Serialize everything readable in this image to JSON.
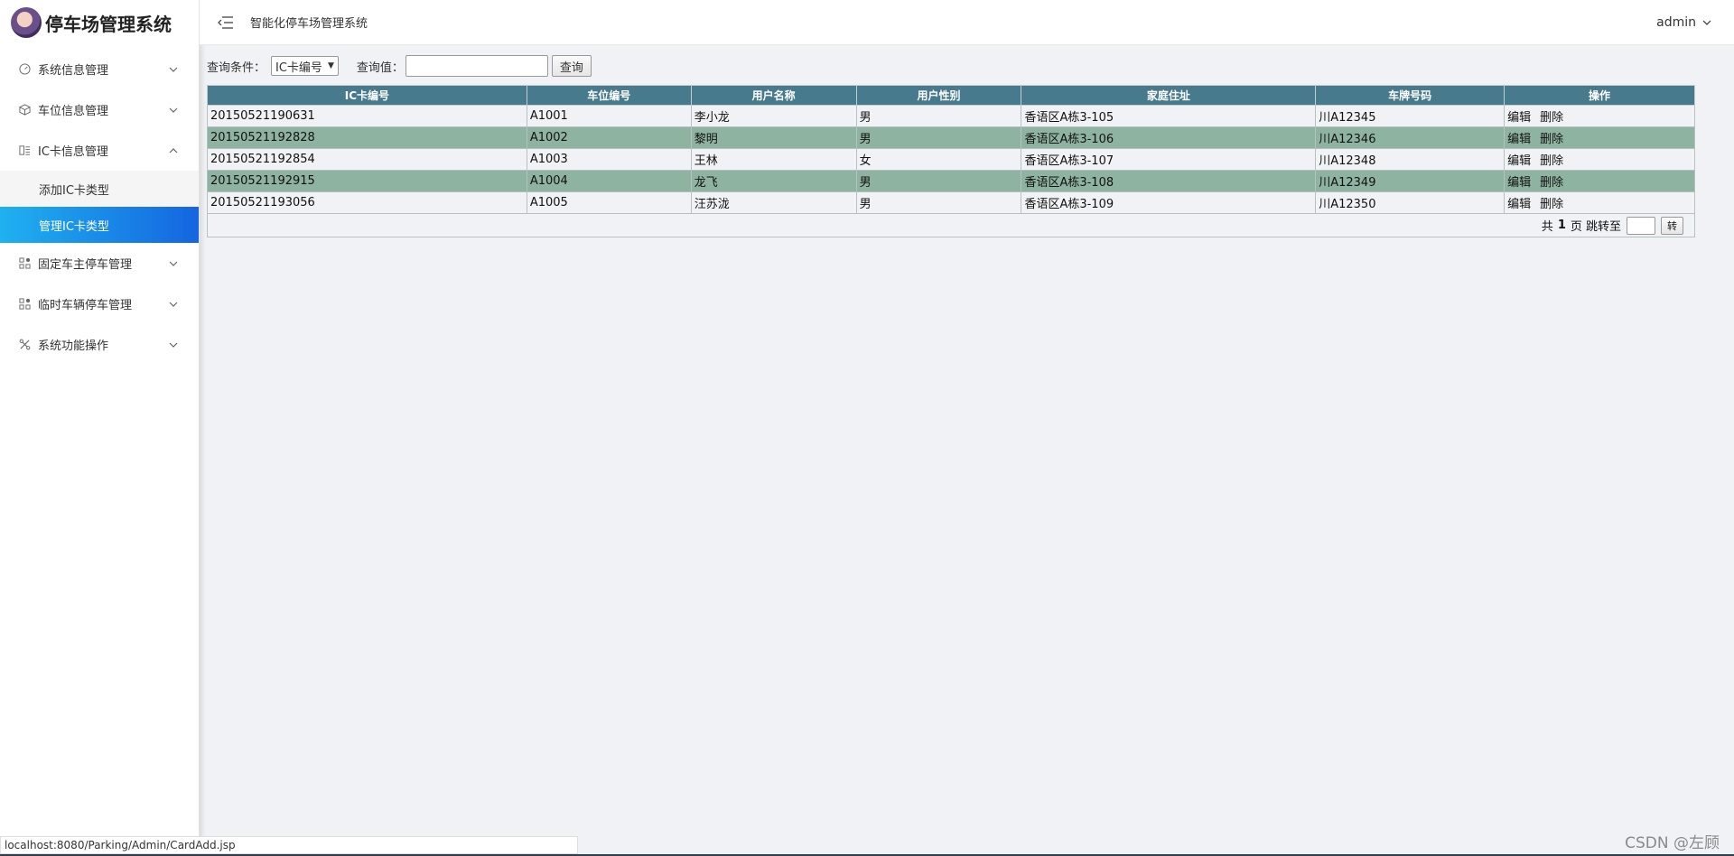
{
  "brand": {
    "title": "停车场管理系统"
  },
  "header": {
    "title": "智能化停车场管理系统",
    "user": "admin"
  },
  "sidebar": {
    "items": [
      {
        "label": "系统信息管理",
        "icon": "gauge-icon",
        "expanded": false
      },
      {
        "label": "车位信息管理",
        "icon": "cube-icon",
        "expanded": false
      },
      {
        "label": "IC卡信息管理",
        "icon": "card-icon",
        "expanded": true,
        "children": [
          {
            "label": "添加IC卡类型",
            "active": false
          },
          {
            "label": "管理IC卡类型",
            "active": true
          }
        ]
      },
      {
        "label": "固定车主停车管理",
        "icon": "grid-icon",
        "expanded": false
      },
      {
        "label": "临时车辆停车管理",
        "icon": "grid-icon",
        "expanded": false
      },
      {
        "label": "系统功能操作",
        "icon": "tools-icon",
        "expanded": false
      }
    ],
    "active_color": "#1e88e5"
  },
  "query": {
    "condition_label": "查询条件：",
    "condition_value": "IC卡编号",
    "value_label": "查询值：",
    "value": "",
    "button": "查询"
  },
  "table": {
    "header_color": "#467a8c",
    "row_alt_color": "#8fb3a1",
    "columns": [
      "IC卡编号",
      "车位编号",
      "用户名称",
      "用户性别",
      "家庭住址",
      "车牌号码",
      "操作"
    ],
    "rows": [
      {
        "card": "20150521190631",
        "slot": "A1001",
        "name": "李小龙",
        "gender": "男",
        "address": "香语区A栋3-105",
        "plate": "川A12345"
      },
      {
        "card": "20150521192828",
        "slot": "A1002",
        "name": "黎明",
        "gender": "男",
        "address": "香语区A栋3-106",
        "plate": "川A12346"
      },
      {
        "card": "20150521192854",
        "slot": "A1003",
        "name": "王林",
        "gender": "女",
        "address": "香语区A栋3-107",
        "plate": "川A12348"
      },
      {
        "card": "20150521192915",
        "slot": "A1004",
        "name": "龙飞",
        "gender": "男",
        "address": "香语区A栋3-108",
        "plate": "川A12349"
      },
      {
        "card": "20150521193056",
        "slot": "A1005",
        "name": "汪苏泷",
        "gender": "男",
        "address": "香语区A栋3-109",
        "plate": "川A12350"
      }
    ],
    "edit_label": "编辑",
    "delete_label": "删除"
  },
  "pager": {
    "prefix": "共",
    "total_pages": "1",
    "suffix": "页 跳转至",
    "go_label": "转"
  },
  "statusbar": {
    "url": "localhost:8080/Parking/Admin/CardAdd.jsp"
  },
  "watermark": "CSDN @左顾"
}
